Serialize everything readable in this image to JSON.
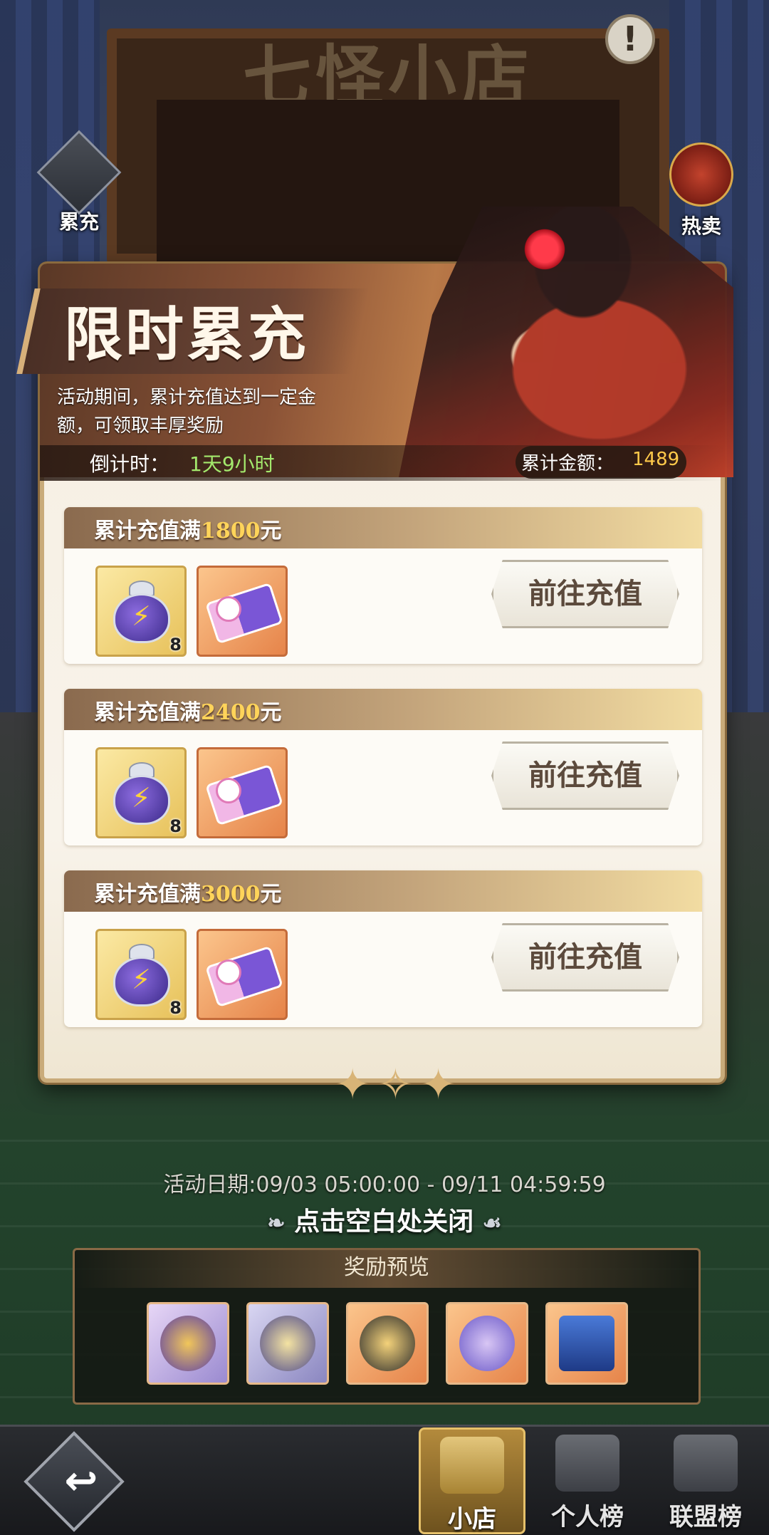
{
  "shop": {
    "title": "七怪小店",
    "info_icon": "!"
  },
  "side_buttons": {
    "left": [
      {
        "label": "累充",
        "icon": "gift-box-icon"
      }
    ],
    "right": [
      {
        "label": "热卖",
        "icon": "gift-chest-icon"
      }
    ]
  },
  "event": {
    "title": "限时累充",
    "description": "活动期间，累计充值达到一定金额，可领取丰厚奖励",
    "countdown_label": "倒计时：",
    "countdown_value": "1天9小时",
    "total_label": "累计金额：",
    "total_value": "1489",
    "tiers": [
      {
        "prefix": "累计充值满",
        "amount": "1800",
        "suffix": "元",
        "rewards": [
          {
            "icon": "energy-teapot-icon",
            "qty": "8"
          },
          {
            "icon": "ticket-icon",
            "qty": ""
          }
        ],
        "button": "前往充值"
      },
      {
        "prefix": "累计充值满",
        "amount": "2400",
        "suffix": "元",
        "rewards": [
          {
            "icon": "energy-teapot-icon",
            "qty": "8"
          },
          {
            "icon": "ticket-icon",
            "qty": ""
          }
        ],
        "button": "前往充值"
      },
      {
        "prefix": "累计充值满",
        "amount": "3000",
        "suffix": "元",
        "rewards": [
          {
            "icon": "energy-teapot-icon",
            "qty": "8"
          },
          {
            "icon": "ticket-icon",
            "qty": ""
          }
        ],
        "button": "前往充值"
      }
    ]
  },
  "footer": {
    "event_date": "活动日期:09/03 05:00:00 - 09/11 04:59:59",
    "close_hint": "点击空白处关闭"
  },
  "preview": {
    "title": "奖励预览",
    "items": [
      {
        "icon": "emblem-badge-icon"
      },
      {
        "icon": "crest-badge-icon"
      },
      {
        "icon": "star-coin-icon"
      },
      {
        "icon": "lucky-badge-icon"
      },
      {
        "icon": "treasure-chest-icon"
      }
    ]
  },
  "nav": {
    "back_icon": "back-arrow-icon",
    "tabs": [
      {
        "label": "小店",
        "icon": "shop-icon",
        "active": true
      },
      {
        "label": "个人榜",
        "icon": "personal-rank-icon",
        "active": false
      },
      {
        "label": "联盟榜",
        "icon": "alliance-rank-icon",
        "active": false
      }
    ]
  },
  "colors": {
    "accent_gold": "#ffd45a",
    "countdown_green": "#a3e86c",
    "total_yellow": "#ffc94a"
  }
}
